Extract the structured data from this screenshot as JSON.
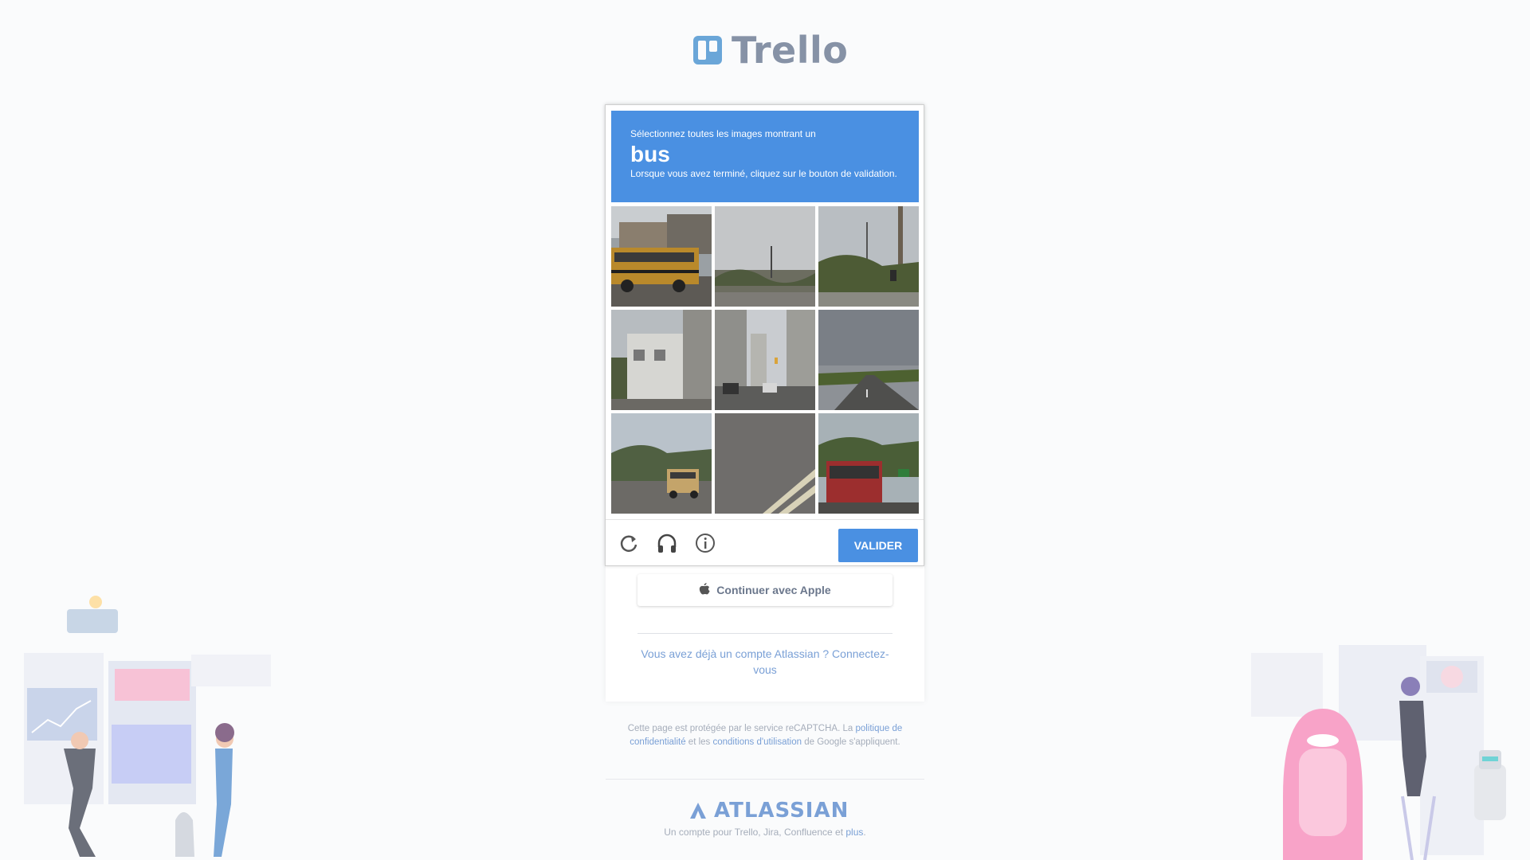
{
  "brand": {
    "name": "Trello",
    "accent": "#4a90e2"
  },
  "captcha": {
    "instruction": "Sélectionnez toutes les images montrant un",
    "target": "bus",
    "hint": "Lorsque vous avez terminé, cliquez sur le bouton de validation.",
    "tiles": [
      {
        "label": "tile-1"
      },
      {
        "label": "tile-2"
      },
      {
        "label": "tile-3"
      },
      {
        "label": "tile-4"
      },
      {
        "label": "tile-5"
      },
      {
        "label": "tile-6"
      },
      {
        "label": "tile-7"
      },
      {
        "label": "tile-8"
      },
      {
        "label": "tile-9"
      }
    ],
    "footer_icons": [
      "reload-icon",
      "headphones-icon",
      "info-icon"
    ],
    "verify_label": "VALIDER"
  },
  "apple_button": {
    "label": "Continuer avec Apple",
    "icon": "apple-icon"
  },
  "login_link": "Vous avez déjà un compte Atlassian ? Connectez-vous",
  "recaptcha_note": {
    "before": "Cette page est protégée par le service reCAPTCHA. La ",
    "privacy": "politique de confidentialité",
    "middle": " et les ",
    "terms": "conditions d'utilisation",
    "after": " de Google s'appliquent."
  },
  "footer": {
    "brand": "ATLASSIAN",
    "tagline_before": "Un compte pour Trello, Jira, Confluence et ",
    "tagline_link": "plus",
    "tagline_after": "."
  }
}
